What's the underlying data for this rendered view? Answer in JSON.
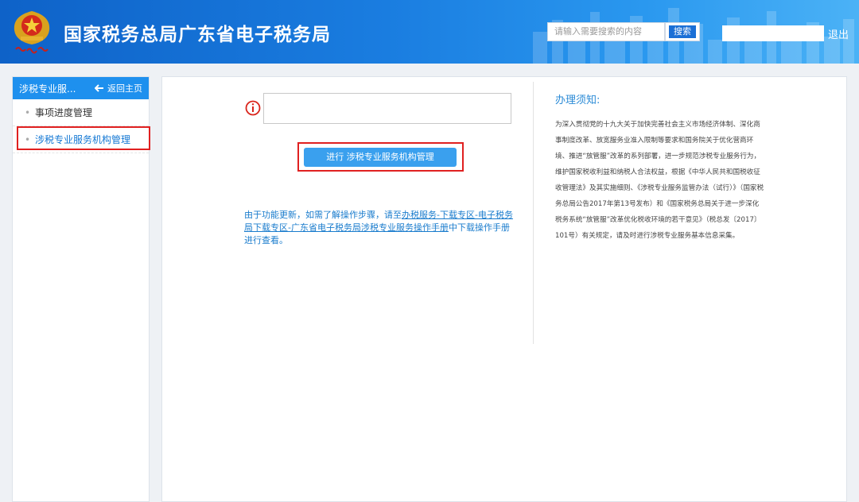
{
  "header": {
    "title": "国家税务总局广东省电子税务局",
    "search_placeholder": "请输入需要搜索的内容",
    "search_button": "搜索",
    "logout": "退出"
  },
  "sidebar": {
    "title": "涉税专业服...",
    "back_label": "返回主页",
    "items": [
      {
        "label": "事项进度管理",
        "active": false
      },
      {
        "label": "涉税专业服务机构管理",
        "active": true
      }
    ]
  },
  "main": {
    "action_button": "进行 涉税专业服务机构管理",
    "notice_prefix": "由于功能更新，如需了解操作步骤，请至",
    "notice_link": "办税服务-下载专区-电子税务局下载专区-广东省电子税务局涉税专业服务操作手册",
    "notice_suffix": "中下载操作手册进行查看。",
    "tips_title": "办理须知:",
    "tips_body": "为深入贯彻党的十九大关于加快完善社会主义市场经济体制、深化商事制度改革、放宽服务业准入限制等要求和国务院关于优化营商环境、推进“放管服”改革的系列部署，进一步规范涉税专业服务行为，维护国家税收利益和纳税人合法权益，根据《中华人民共和国税收征收管理法》及其实施细则、《涉税专业服务监管办法（试行）》（国家税务总局公告2017年第13号发布）和《国家税务总局关于进一步深化税务系统“放管服”改革优化税收环境的若干意见》（税总发〔2017〕101号）有关规定，请及时进行涉税专业服务基本信息采集。"
  },
  "colors": {
    "header_blue": "#1a7de0",
    "accent": "#1e90ee",
    "highlight_red": "#e02020",
    "link_blue": "#1a7ccd"
  },
  "icons": [
    "tax-emblem-logo",
    "back-arrow-icon",
    "info-icon"
  ]
}
